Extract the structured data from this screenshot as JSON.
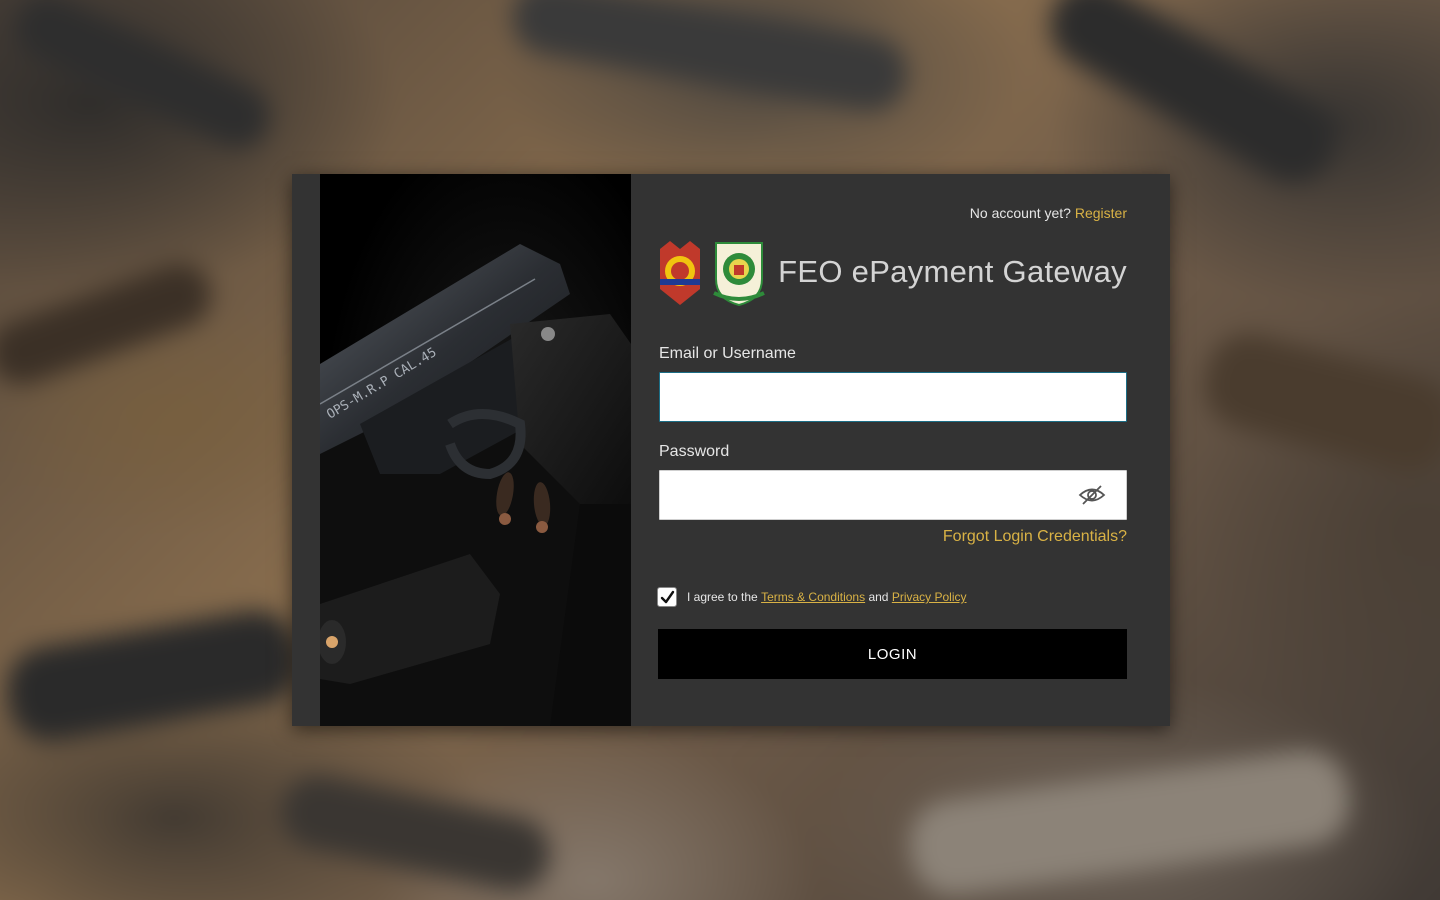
{
  "header": {
    "no_account_text": "No account yet?",
    "register_link": "Register"
  },
  "brand": {
    "title": "FEO ePayment Gateway",
    "logos": [
      "pnp-seal-icon",
      "csg-seal-icon"
    ]
  },
  "form": {
    "email_label": "Email or Username",
    "email_value": "",
    "password_label": "Password",
    "password_value": "",
    "forgot_link": "Forgot Login Credentials?",
    "agree_checked": true,
    "agree_prefix": "I agree to the",
    "terms_link": "Terms & Conditions",
    "agree_and": "and",
    "privacy_link": "Privacy Policy",
    "login_button": "LOGIN"
  },
  "colors": {
    "card_bg": "#333333",
    "accent": "#d9b245",
    "button_bg": "#000000"
  }
}
